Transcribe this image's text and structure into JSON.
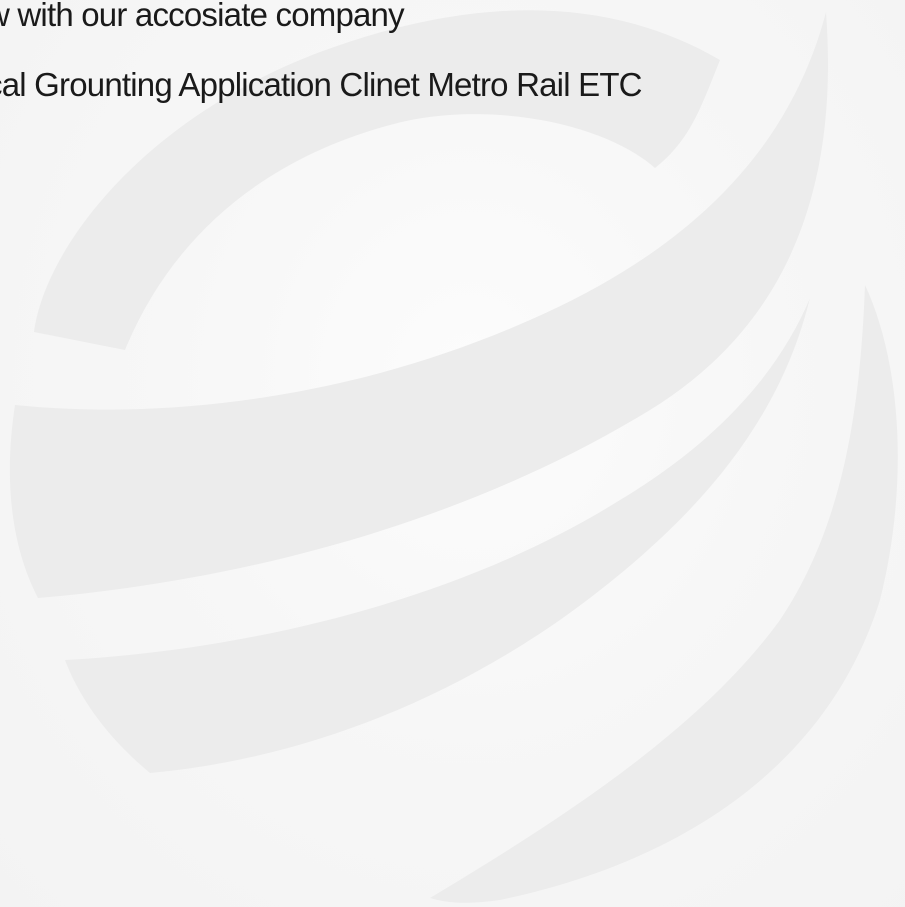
{
  "text_lines": {
    "line1": "w with our accosiate company",
    "line2": "cal Grounting Application Clinet Metro Rail ETC"
  },
  "watermark": {
    "icon": "globe-swoosh-logo",
    "color": "#ececec"
  }
}
